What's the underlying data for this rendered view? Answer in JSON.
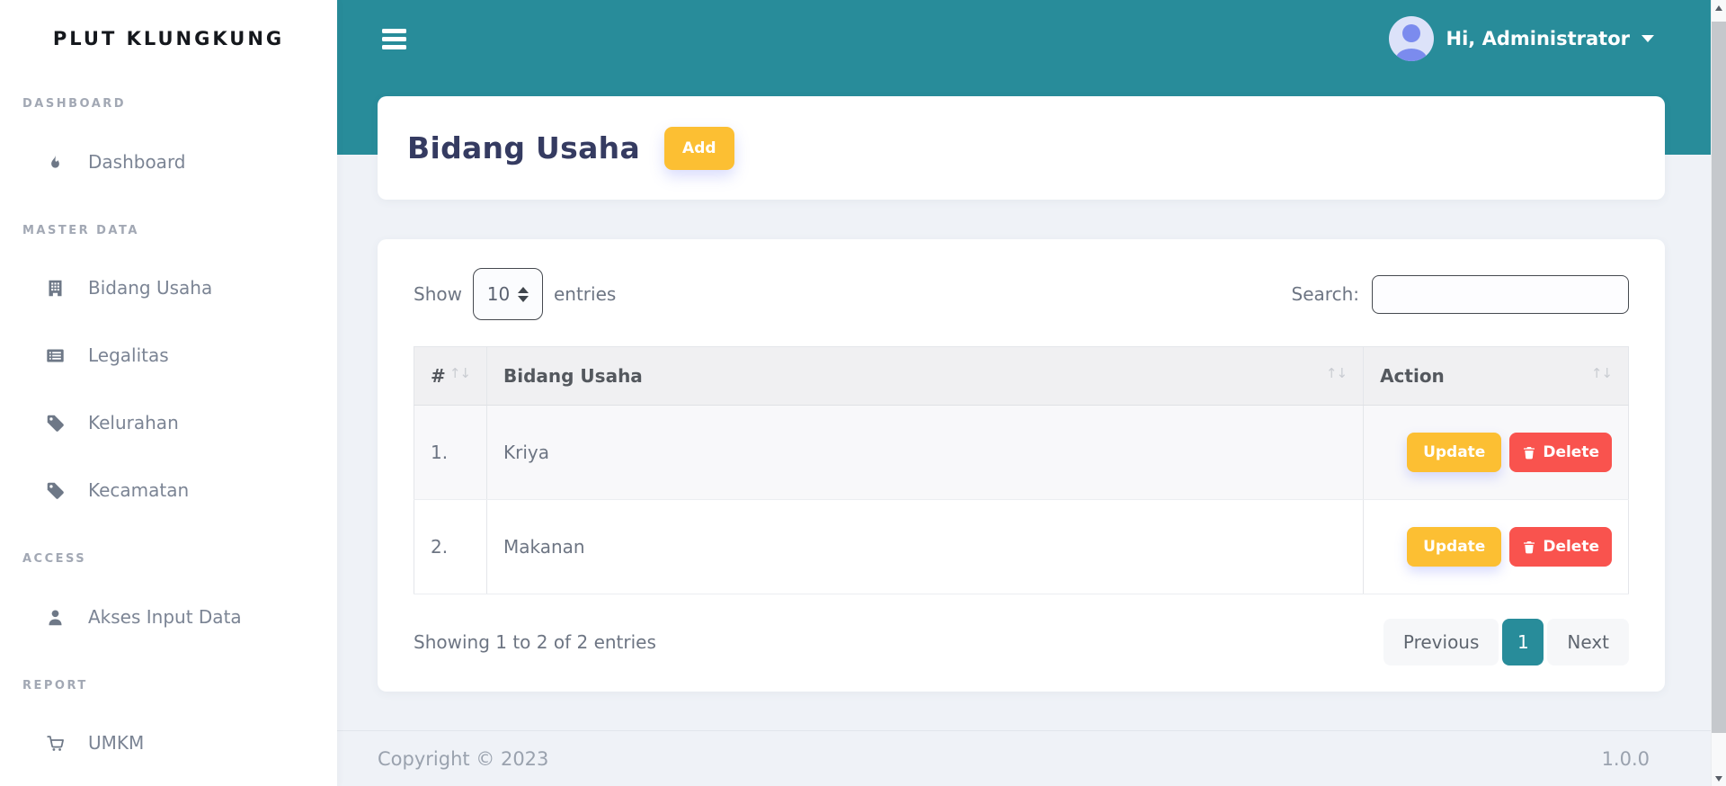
{
  "sidebar": {
    "brand": "PLUT KLUNGKUNG",
    "sections": [
      {
        "label": "DASHBOARD",
        "items": [
          {
            "label": "Dashboard",
            "icon": "flame-icon"
          }
        ]
      },
      {
        "label": "MASTER DATA",
        "items": [
          {
            "label": "Bidang Usaha",
            "icon": "building-icon"
          },
          {
            "label": "Legalitas",
            "icon": "list-icon"
          },
          {
            "label": "Kelurahan",
            "icon": "tag-icon"
          },
          {
            "label": "Kecamatan",
            "icon": "tag-icon"
          }
        ]
      },
      {
        "label": "ACCESS",
        "items": [
          {
            "label": "Akses Input Data",
            "icon": "user-icon"
          }
        ]
      },
      {
        "label": "REPORT",
        "items": [
          {
            "label": "UMKM",
            "icon": "cart-icon"
          }
        ]
      }
    ]
  },
  "topbar": {
    "user_greeting": "Hi, Administrator"
  },
  "page": {
    "title": "Bidang Usaha",
    "add_button": "Add"
  },
  "table_card": {
    "length_label_before": "Show",
    "length_value": "10",
    "length_label_after": "entries",
    "search_label": "Search:",
    "search_value": "",
    "columns": [
      "#",
      "Bidang Usaha",
      "Action"
    ],
    "sort_glyph": "↑↓",
    "rows": [
      {
        "num": "1.",
        "name": "Kriya"
      },
      {
        "num": "2.",
        "name": "Makanan"
      }
    ],
    "update_label": "Update",
    "delete_label": "Delete",
    "info": "Showing 1 to 2 of 2 entries",
    "pagination": {
      "previous": "Previous",
      "current": "1",
      "next": "Next"
    }
  },
  "footer": {
    "copyright": "Copyright © 2023",
    "version": "1.0.0"
  },
  "colors": {
    "teal": "#288c9a",
    "yellow": "#fcbf33",
    "red": "#f9534e",
    "navy": "#353b61"
  }
}
